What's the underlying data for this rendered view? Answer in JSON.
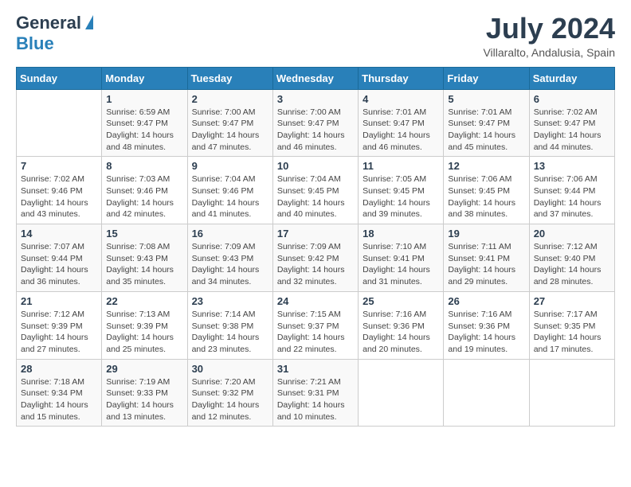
{
  "header": {
    "logo_general": "General",
    "logo_blue": "Blue",
    "month_year": "July 2024",
    "location": "Villaralto, Andalusia, Spain"
  },
  "days_of_week": [
    "Sunday",
    "Monday",
    "Tuesday",
    "Wednesday",
    "Thursday",
    "Friday",
    "Saturday"
  ],
  "weeks": [
    [
      {
        "number": "",
        "sunrise": "",
        "sunset": "",
        "daylight": ""
      },
      {
        "number": "1",
        "sunrise": "Sunrise: 6:59 AM",
        "sunset": "Sunset: 9:47 PM",
        "daylight": "Daylight: 14 hours and 48 minutes."
      },
      {
        "number": "2",
        "sunrise": "Sunrise: 7:00 AM",
        "sunset": "Sunset: 9:47 PM",
        "daylight": "Daylight: 14 hours and 47 minutes."
      },
      {
        "number": "3",
        "sunrise": "Sunrise: 7:00 AM",
        "sunset": "Sunset: 9:47 PM",
        "daylight": "Daylight: 14 hours and 46 minutes."
      },
      {
        "number": "4",
        "sunrise": "Sunrise: 7:01 AM",
        "sunset": "Sunset: 9:47 PM",
        "daylight": "Daylight: 14 hours and 46 minutes."
      },
      {
        "number": "5",
        "sunrise": "Sunrise: 7:01 AM",
        "sunset": "Sunset: 9:47 PM",
        "daylight": "Daylight: 14 hours and 45 minutes."
      },
      {
        "number": "6",
        "sunrise": "Sunrise: 7:02 AM",
        "sunset": "Sunset: 9:47 PM",
        "daylight": "Daylight: 14 hours and 44 minutes."
      }
    ],
    [
      {
        "number": "7",
        "sunrise": "Sunrise: 7:02 AM",
        "sunset": "Sunset: 9:46 PM",
        "daylight": "Daylight: 14 hours and 43 minutes."
      },
      {
        "number": "8",
        "sunrise": "Sunrise: 7:03 AM",
        "sunset": "Sunset: 9:46 PM",
        "daylight": "Daylight: 14 hours and 42 minutes."
      },
      {
        "number": "9",
        "sunrise": "Sunrise: 7:04 AM",
        "sunset": "Sunset: 9:46 PM",
        "daylight": "Daylight: 14 hours and 41 minutes."
      },
      {
        "number": "10",
        "sunrise": "Sunrise: 7:04 AM",
        "sunset": "Sunset: 9:45 PM",
        "daylight": "Daylight: 14 hours and 40 minutes."
      },
      {
        "number": "11",
        "sunrise": "Sunrise: 7:05 AM",
        "sunset": "Sunset: 9:45 PM",
        "daylight": "Daylight: 14 hours and 39 minutes."
      },
      {
        "number": "12",
        "sunrise": "Sunrise: 7:06 AM",
        "sunset": "Sunset: 9:45 PM",
        "daylight": "Daylight: 14 hours and 38 minutes."
      },
      {
        "number": "13",
        "sunrise": "Sunrise: 7:06 AM",
        "sunset": "Sunset: 9:44 PM",
        "daylight": "Daylight: 14 hours and 37 minutes."
      }
    ],
    [
      {
        "number": "14",
        "sunrise": "Sunrise: 7:07 AM",
        "sunset": "Sunset: 9:44 PM",
        "daylight": "Daylight: 14 hours and 36 minutes."
      },
      {
        "number": "15",
        "sunrise": "Sunrise: 7:08 AM",
        "sunset": "Sunset: 9:43 PM",
        "daylight": "Daylight: 14 hours and 35 minutes."
      },
      {
        "number": "16",
        "sunrise": "Sunrise: 7:09 AM",
        "sunset": "Sunset: 9:43 PM",
        "daylight": "Daylight: 14 hours and 34 minutes."
      },
      {
        "number": "17",
        "sunrise": "Sunrise: 7:09 AM",
        "sunset": "Sunset: 9:42 PM",
        "daylight": "Daylight: 14 hours and 32 minutes."
      },
      {
        "number": "18",
        "sunrise": "Sunrise: 7:10 AM",
        "sunset": "Sunset: 9:41 PM",
        "daylight": "Daylight: 14 hours and 31 minutes."
      },
      {
        "number": "19",
        "sunrise": "Sunrise: 7:11 AM",
        "sunset": "Sunset: 9:41 PM",
        "daylight": "Daylight: 14 hours and 29 minutes."
      },
      {
        "number": "20",
        "sunrise": "Sunrise: 7:12 AM",
        "sunset": "Sunset: 9:40 PM",
        "daylight": "Daylight: 14 hours and 28 minutes."
      }
    ],
    [
      {
        "number": "21",
        "sunrise": "Sunrise: 7:12 AM",
        "sunset": "Sunset: 9:39 PM",
        "daylight": "Daylight: 14 hours and 27 minutes."
      },
      {
        "number": "22",
        "sunrise": "Sunrise: 7:13 AM",
        "sunset": "Sunset: 9:39 PM",
        "daylight": "Daylight: 14 hours and 25 minutes."
      },
      {
        "number": "23",
        "sunrise": "Sunrise: 7:14 AM",
        "sunset": "Sunset: 9:38 PM",
        "daylight": "Daylight: 14 hours and 23 minutes."
      },
      {
        "number": "24",
        "sunrise": "Sunrise: 7:15 AM",
        "sunset": "Sunset: 9:37 PM",
        "daylight": "Daylight: 14 hours and 22 minutes."
      },
      {
        "number": "25",
        "sunrise": "Sunrise: 7:16 AM",
        "sunset": "Sunset: 9:36 PM",
        "daylight": "Daylight: 14 hours and 20 minutes."
      },
      {
        "number": "26",
        "sunrise": "Sunrise: 7:16 AM",
        "sunset": "Sunset: 9:36 PM",
        "daylight": "Daylight: 14 hours and 19 minutes."
      },
      {
        "number": "27",
        "sunrise": "Sunrise: 7:17 AM",
        "sunset": "Sunset: 9:35 PM",
        "daylight": "Daylight: 14 hours and 17 minutes."
      }
    ],
    [
      {
        "number": "28",
        "sunrise": "Sunrise: 7:18 AM",
        "sunset": "Sunset: 9:34 PM",
        "daylight": "Daylight: 14 hours and 15 minutes."
      },
      {
        "number": "29",
        "sunrise": "Sunrise: 7:19 AM",
        "sunset": "Sunset: 9:33 PM",
        "daylight": "Daylight: 14 hours and 13 minutes."
      },
      {
        "number": "30",
        "sunrise": "Sunrise: 7:20 AM",
        "sunset": "Sunset: 9:32 PM",
        "daylight": "Daylight: 14 hours and 12 minutes."
      },
      {
        "number": "31",
        "sunrise": "Sunrise: 7:21 AM",
        "sunset": "Sunset: 9:31 PM",
        "daylight": "Daylight: 14 hours and 10 minutes."
      },
      {
        "number": "",
        "sunrise": "",
        "sunset": "",
        "daylight": ""
      },
      {
        "number": "",
        "sunrise": "",
        "sunset": "",
        "daylight": ""
      },
      {
        "number": "",
        "sunrise": "",
        "sunset": "",
        "daylight": ""
      }
    ]
  ]
}
